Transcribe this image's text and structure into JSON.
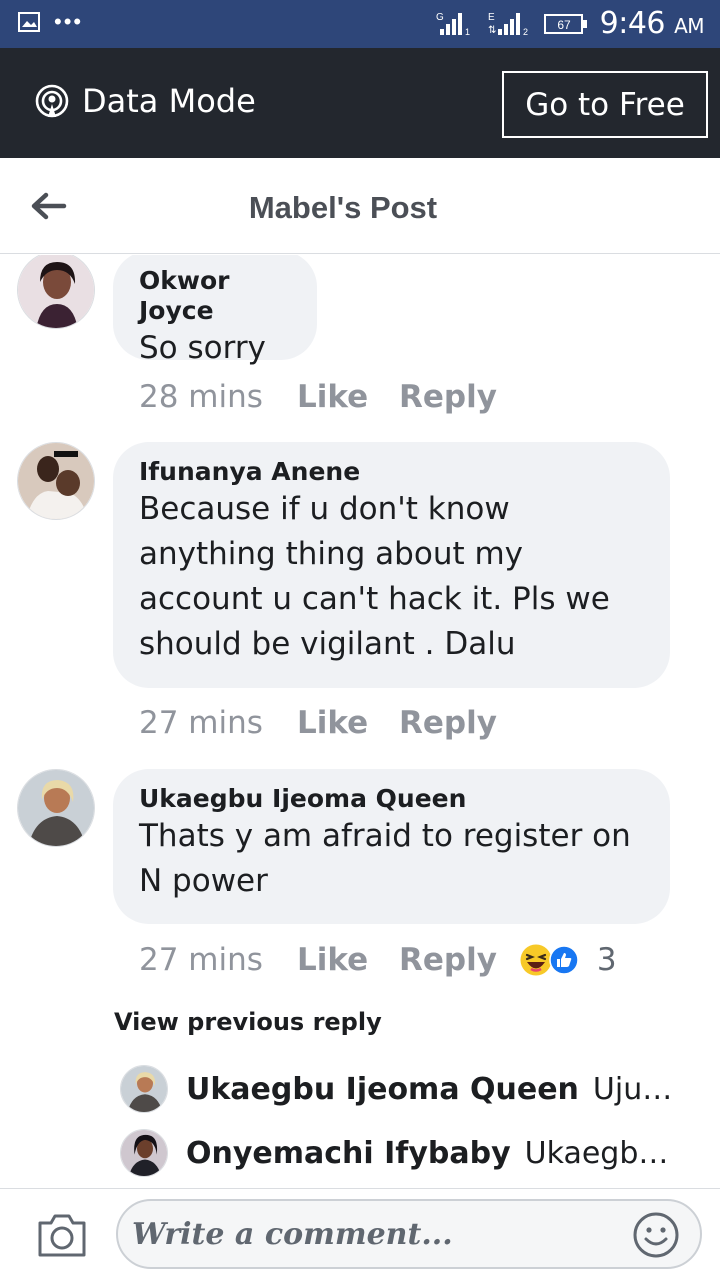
{
  "status_bar": {
    "time": "9:46",
    "am_pm": "AM",
    "battery": "67",
    "sim1_label": "G",
    "sim2_label": "E"
  },
  "data_bar": {
    "label": "Data Mode",
    "button_label": "Go to Free"
  },
  "header": {
    "title": "Mabel's Post"
  },
  "comments": [
    {
      "name": "Okwor Joyce",
      "text": "So sorry",
      "time": "28 mins",
      "like_label": "Like",
      "reply_label": "Reply"
    },
    {
      "name": "Ifunanya Anene",
      "text": "Because if u don't know anything thing about my account u can't hack it. Pls we should be vigilant . Dalu",
      "time": "27 mins",
      "like_label": "Like",
      "reply_label": "Reply"
    },
    {
      "name": "Ukaegbu Ijeoma Queen",
      "text": "Thats y am afraid to register on N power",
      "time": "27 mins",
      "like_label": "Like",
      "reply_label": "Reply",
      "reaction_icons": [
        "haha-icon",
        "like-reaction-icon"
      ],
      "reaction_count": "3"
    }
  ],
  "replies": {
    "view_previous_label": "View previous reply",
    "items": [
      {
        "name": "Ukaegbu Ijeoma Queen",
        "text": "Uju M..."
      },
      {
        "name": "Onyemachi Ifybaby",
        "text": "Ukaegbu Ij..."
      }
    ]
  },
  "composer": {
    "placeholder": "Write a comment..."
  },
  "colors": {
    "status_bar": "#2e4679",
    "data_bar": "#23272e",
    "bubble": "#f0f2f5",
    "meta_text": "#90949c",
    "like_blue": "#1877f2",
    "haha_yellow": "#f7c928"
  }
}
